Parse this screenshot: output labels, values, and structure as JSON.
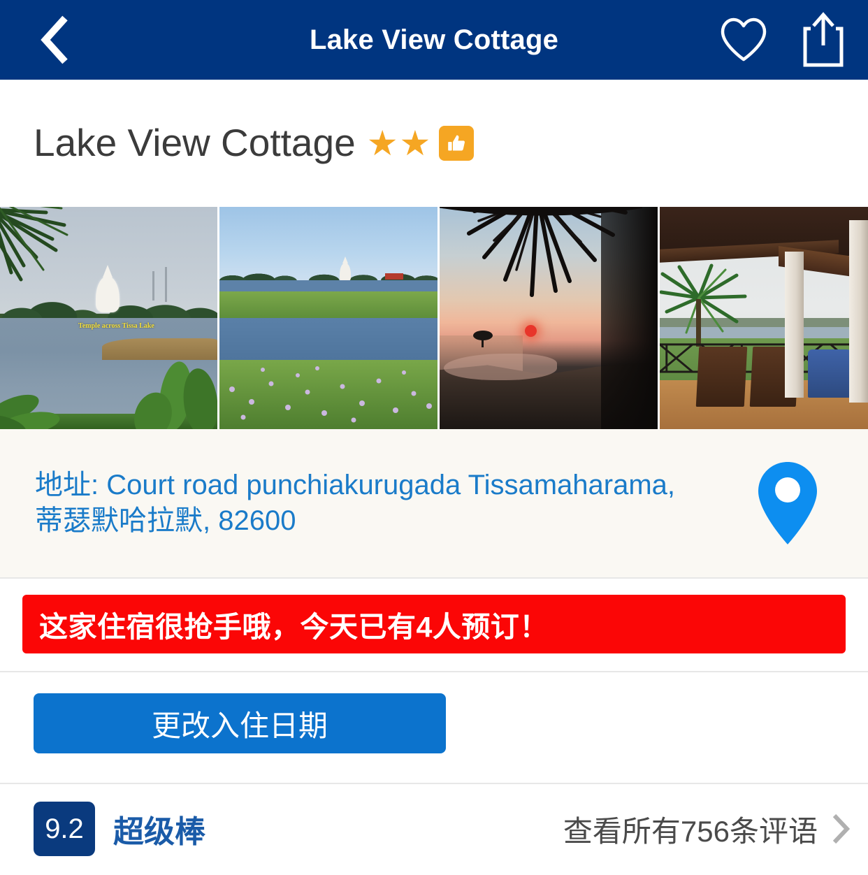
{
  "header": {
    "title": "Lake View Cottage",
    "back_icon": "chevron-left-icon",
    "favorite_icon": "heart-outline-icon",
    "share_icon": "share-upload-icon",
    "background_color": "#003580"
  },
  "property": {
    "name": "Lake View Cottage",
    "star_rating": 2,
    "star_glyph": "★",
    "star_color": "#f5a623",
    "thumbs_up_badge": "👍",
    "thumbs_up_present": true
  },
  "gallery": {
    "photos": [
      {
        "alt": "Temple across Tissa Lake seen through palm fronds",
        "caption": "Temple across Tissa Lake"
      },
      {
        "alt": "Tissa Lake covered with flowering water hyacinth",
        "caption": ""
      },
      {
        "alt": "Sunset over the lake framed by palm leaves",
        "caption": ""
      },
      {
        "alt": "Covered veranda with wooden deck chairs overlooking the lake",
        "caption": ""
      }
    ]
  },
  "address": {
    "label": "地址:",
    "value": "地址: Court road punchiakurugada Tissamaharama, 蒂瑟默哈拉默, 82600",
    "text_color": "#1a7bc9",
    "pin_icon": "map-pin-icon",
    "pin_color": "#0d8ef0"
  },
  "hot_banner": {
    "text": "这家住宿很抢手哦，今天已有4人预订！",
    "bookings_today": 4,
    "background_color": "#fb0606"
  },
  "actions": {
    "change_dates_label": "更改入住日期",
    "change_dates_color": "#0c73cd"
  },
  "review_summary": {
    "score": "9.2",
    "score_word": "超级棒",
    "reviews_link_label": "查看所有756条评语",
    "review_count": 756,
    "chevron_icon": "chevron-right-icon",
    "badge_color": "#0a3a7e"
  }
}
